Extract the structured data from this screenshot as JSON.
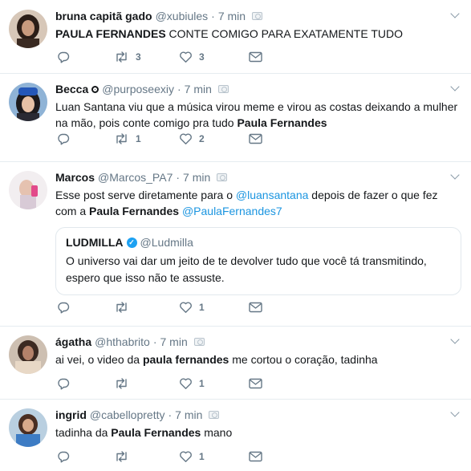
{
  "tweets": [
    {
      "name": "bruna capitã gado",
      "handle": "@xubiules",
      "time": "7 min",
      "segments": [
        {
          "t": "PAULA FERNANDES",
          "s": "b"
        },
        {
          "t": " CONTE COMIGO PARA EXATAMENTE TUDO",
          "s": ""
        }
      ],
      "retweets": "3",
      "likes": "3"
    },
    {
      "name": "Becca",
      "handle": "@purposeexiy",
      "time": "7 min",
      "segments": [
        {
          "t": "Luan Santana viu que a música virou meme e virou as costas deixando a mulher na mão, pois conte comigo pra tudo ",
          "s": ""
        },
        {
          "t": "Paula Fernandes",
          "s": "b"
        }
      ],
      "retweets": "1",
      "likes": "2"
    },
    {
      "name": "Marcos",
      "handle": "@Marcos_PA7",
      "time": "7 min",
      "segments": [
        {
          "t": "Esse post serve diretamente para o ",
          "s": ""
        },
        {
          "t": "@luansantana",
          "s": "link"
        },
        {
          "t": "  depois de fazer o que fez com a ",
          "s": ""
        },
        {
          "t": "Paula Fernandes",
          "s": "b"
        },
        {
          "t": " ",
          "s": ""
        },
        {
          "t": "@PaulaFernandes7",
          "s": "link"
        }
      ],
      "quote": {
        "name": "LUDMILLA",
        "verified": "✓",
        "handle": "@Ludmilla",
        "text": "O universo vai dar um jeito de te devolver tudo que você tá transmitindo, espero que isso não te assuste."
      },
      "retweets": "",
      "likes": "1"
    },
    {
      "name": "ágatha",
      "handle": "@hthabrito",
      "time": "7 min",
      "segments": [
        {
          "t": "ai vei, o video da ",
          "s": ""
        },
        {
          "t": "paula fernandes",
          "s": "b"
        },
        {
          "t": " me cortou o coração, tadinha",
          "s": ""
        }
      ],
      "retweets": "",
      "likes": "1"
    },
    {
      "name": "ingrid",
      "handle": "@cabellopretty",
      "time": "7 min",
      "segments": [
        {
          "t": "tadinha da ",
          "s": ""
        },
        {
          "t": "Paula Fernandes",
          "s": "b"
        },
        {
          "t": " mano",
          "s": ""
        }
      ],
      "retweets": "",
      "likes": "1"
    }
  ],
  "colors": {
    "text": "#14171a",
    "muted": "#657786",
    "link": "#1b95e0",
    "border": "#e6ecf0",
    "icon": "#657786"
  },
  "icons": {
    "reply": "reply-icon",
    "retweet": "retweet-icon",
    "like": "heart-icon",
    "dm": "envelope-icon",
    "menu": "chevron-down-icon",
    "media": "camera-icon",
    "verified": "verified-badge-icon"
  }
}
